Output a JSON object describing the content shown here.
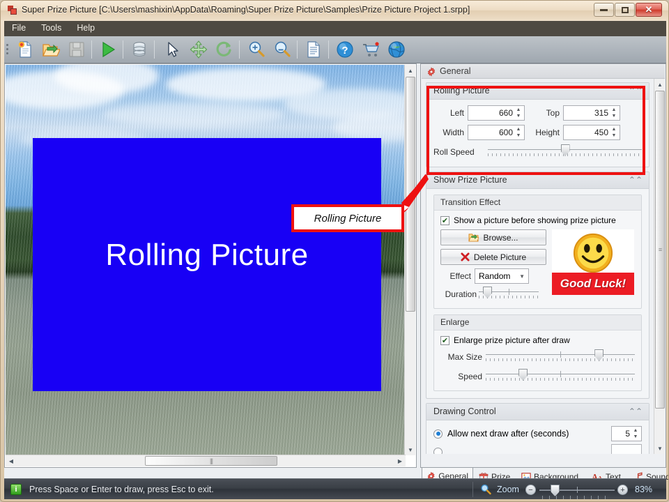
{
  "window": {
    "title": "Super Prize Picture [C:\\Users\\mashixin\\AppData\\Roaming\\Super Prize Picture\\Samples\\Prize Picture Project 1.srpp]",
    "title_icon": "app-icon",
    "buttons": {
      "minimize": "–",
      "maximize": "❐",
      "close": "✕"
    }
  },
  "menu": {
    "items": [
      "File",
      "Tools",
      "Help"
    ]
  },
  "toolbar": {
    "items": [
      {
        "name": "new-project-icon",
        "tip": "New"
      },
      {
        "name": "open-project-icon",
        "tip": "Open"
      },
      {
        "name": "save-icon",
        "tip": "Save"
      },
      {
        "name": "run-icon",
        "tip": "Run"
      },
      {
        "name": "database-icon",
        "tip": "Database"
      },
      {
        "name": "select-cursor-icon",
        "tip": "Select"
      },
      {
        "name": "move-icon",
        "tip": "Move"
      },
      {
        "name": "rotate-icon",
        "tip": "Rotate"
      },
      {
        "name": "zoom-in-icon",
        "tip": "Zoom In"
      },
      {
        "name": "zoom-out-icon",
        "tip": "Zoom Out"
      },
      {
        "name": "report-icon",
        "tip": "Report"
      },
      {
        "name": "help-icon",
        "tip": "Help"
      },
      {
        "name": "buy-cart-icon",
        "tip": "Buy"
      },
      {
        "name": "website-globe-icon",
        "tip": "Website"
      }
    ]
  },
  "canvas": {
    "rolling_picture_label": "Rolling Picture",
    "rect_color": "#1800f5"
  },
  "annotation": {
    "callout_text": "Rolling Picture",
    "color": "#ee1111"
  },
  "properties": {
    "header": "General",
    "header_icon": "gear-icon",
    "rolling_picture": {
      "title": "Rolling Picture",
      "fields": [
        {
          "label": "Left",
          "value": "660"
        },
        {
          "label": "Top",
          "value": "315"
        },
        {
          "label": "Width",
          "value": "600"
        },
        {
          "label": "Height",
          "value": "450"
        }
      ],
      "roll_speed": {
        "label": "Roll Speed",
        "percent": 50
      }
    },
    "show_prize_picture": {
      "title": "Show Prize Picture",
      "transition_effect": {
        "title": "Transition Effect",
        "checkbox_label": "Show a picture before showing prize picture",
        "checkbox_checked": true,
        "browse_button": "Browse...",
        "browse_icon": "open-folder-icon",
        "delete_button": "Delete Picture",
        "delete_icon": "red-x-icon",
        "effect_label": "Effect",
        "effect_value": "Random",
        "duration_label": "Duration",
        "duration_percent": 12,
        "preview_caption": "Good Luck!",
        "preview_caption_color": "#ec1c24",
        "preview_icon": "smiley-face-icon"
      },
      "enlarge": {
        "title": "Enlarge",
        "checkbox_label": "Enlarge prize picture after draw",
        "checkbox_checked": true,
        "max_size_label": "Max Size",
        "max_size_percent": 74,
        "speed_label": "Speed",
        "speed_percent": 24
      }
    },
    "drawing_control": {
      "title": "Drawing Control",
      "option_label": "Allow next draw after (seconds)",
      "option_selected": true,
      "option_value": "5"
    }
  },
  "tabs": [
    {
      "label": "General",
      "icon": "gear-icon",
      "active": true
    },
    {
      "label": "Prize",
      "icon": "gift-icon",
      "active": false
    },
    {
      "label": "Background",
      "icon": "image-icon",
      "active": false
    },
    {
      "label": "Text",
      "icon": "font-icon",
      "active": false
    },
    {
      "label": "Sound",
      "icon": "music-note-icon",
      "active": false
    }
  ],
  "statusbar": {
    "icon": "info-icon",
    "icon_glyph": "i",
    "message": "Press Space or Enter to draw, press Esc to exit.",
    "zoom_icon": "magnifier-icon",
    "zoom_label": "Zoom",
    "zoom_minus": "−",
    "zoom_plus": "+",
    "zoom_percent_text": "83%",
    "zoom_slider_percent": 17
  }
}
